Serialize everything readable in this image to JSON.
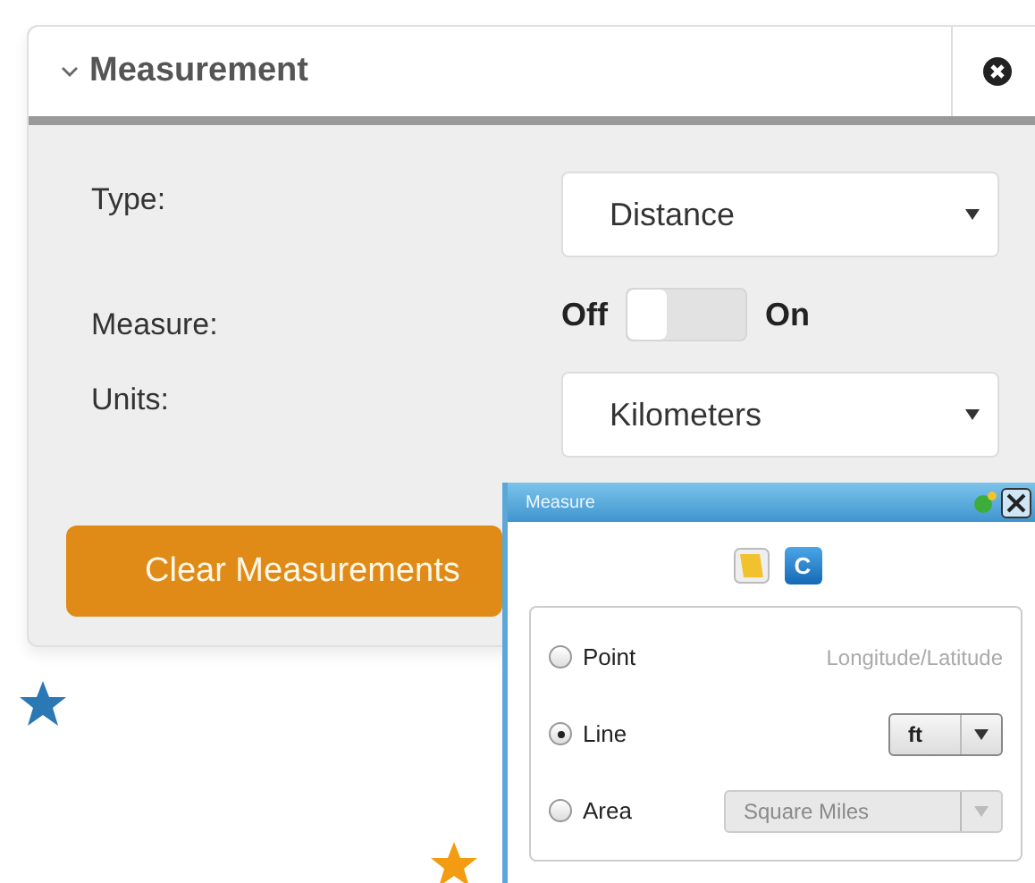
{
  "panel": {
    "title": "Measurement",
    "expanded": true,
    "fields": [
      {
        "kind": "select",
        "label": "Type:",
        "value": "Distance"
      },
      {
        "kind": "toggle",
        "label": "Measure:",
        "off_label": "Off",
        "on_label": "On",
        "on": false
      },
      {
        "kind": "select",
        "label": "Units:",
        "value": "Kilometers"
      }
    ],
    "button": "Clear Measurements"
  },
  "markers": [
    {
      "color": "#2a78b4"
    },
    {
      "color": "#f39c12"
    }
  ],
  "measure_window": {
    "title": "Measure",
    "tools": [
      {
        "kind": "note"
      },
      {
        "kind": "clear",
        "label": "C"
      }
    ],
    "options": [
      {
        "label": "Point",
        "selected": false,
        "kind": "text",
        "value": "Longitude/Latitude"
      },
      {
        "label": "Line",
        "selected": true,
        "kind": "select",
        "value": "ft",
        "disabled": false
      },
      {
        "label": "Area",
        "selected": false,
        "kind": "select",
        "value": "Square Miles",
        "disabled": true
      }
    ]
  }
}
